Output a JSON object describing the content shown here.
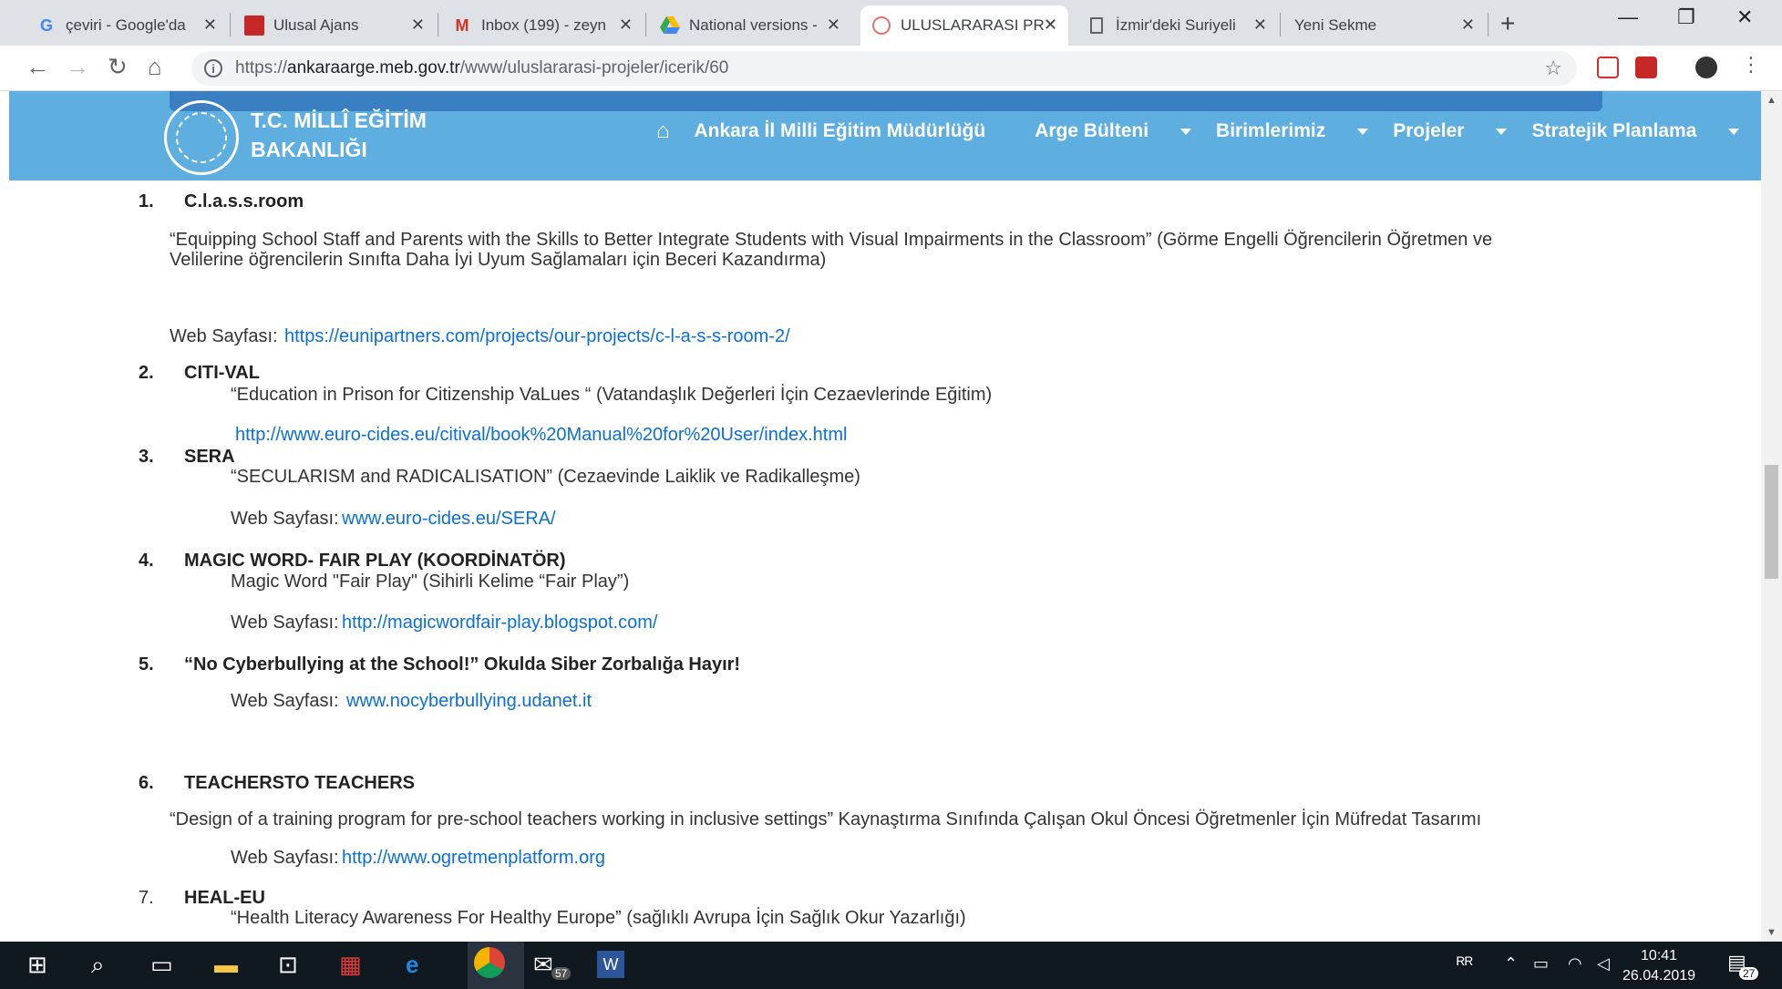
{
  "browser": {
    "tabs": [
      {
        "title": "çeviri - Google'da",
        "icon": "google-g-icon"
      },
      {
        "title": "Ulusal Ajans",
        "icon": "flag-icon"
      },
      {
        "title": "Inbox (199) - zeyn",
        "icon": "gmail-icon"
      },
      {
        "title": "National versions -",
        "icon": "drive-icon"
      },
      {
        "title": "ULUSLARARASI PR",
        "icon": "meb-icon"
      },
      {
        "title": "İzmir'deki Suriyeli",
        "icon": "document-icon"
      },
      {
        "title": "Yeni Sekme",
        "icon": ""
      }
    ],
    "url_prefix": "https://",
    "url_domain": "ankaraarge.meb.gov.tr",
    "url_path": "/www/uluslararasi-projeler/icerik/60"
  },
  "site": {
    "logo_line1": "T.C. MİLLÎ EĞİTİM",
    "logo_line2": "BAKANLIĞI",
    "nav": [
      "Ankara İl Milli Eğitim Müdürlüğü",
      "Arge Bülteni",
      "Birimlerimiz",
      "Projeler",
      "Stratejik Planlama"
    ]
  },
  "projects": {
    "p1": {
      "num": "1.",
      "title": "C.l.a.s.s.room",
      "desc1": "“Equipping School Staff and Parents  with the Skills to Better Integrate Students with Visual Impairments  in the Classroom” (Görme Engelli Öğrencilerin Öğretmen ve",
      "desc2": "Velilerine öğrencilerin Sınıfta Daha İyi Uyum Sağlamaları için Beceri Kazandırma)",
      "web_label": "Web Sayfası:",
      "link": "https://eunipartners.com/projects/our-projects/c-l-a-s-s-room-2/"
    },
    "p2": {
      "num": "2.",
      "title": "CITI-VAL",
      "desc": "“Education in Prison for Citizenship VaLues “ (Vatandaşlık Değerleri İçin Cezaevlerinde Eğitim)",
      "link": "http://www.euro-cides.eu/citival/book%20Manual%20for%20User/index.html"
    },
    "p3": {
      "num": "3.",
      "title": "SERA",
      "desc": "“SECULARISM and RADICALISATION” (Cezaevinde Laiklik ve Radikalleşme)",
      "web_label": "Web Sayfası:",
      "link": "www.euro-cides.eu/SERA/"
    },
    "p4": {
      "num": "4.",
      "title": "MAGIC WORD- FAIR PLAY   (KOORDİNATÖR)",
      "desc": "Magic Word \"Fair Play\"    (Sihirli Kelime “Fair Play”)",
      "web_label": "Web Sayfası:",
      "link": "http://magicwordfair-play.blogspot.com/"
    },
    "p5": {
      "num": "5.",
      "title": "“No Cyberbullying at the School!” Okulda Siber Zorbalığa Hayır!",
      "web_label": "Web Sayfası:",
      "link": "www.nocyberbullying.udanet.it"
    },
    "p6": {
      "num": "6.",
      "title": "TEACHERSTO TEACHERS",
      "desc": "“Design of a training program for pre-school teachers working in inclusive settings” Kaynaştırma Sınıfında Çalışan Okul Öncesi Öğretmenler İçin Müfredat Tasarımı",
      "web_label": "Web Sayfası:",
      "link": "http://www.ogretmenplatform.org"
    },
    "p7": {
      "num": "7.",
      "title": "HEAL-EU",
      "desc": "“Health Literacy Awareness For Healthy Europe”  (sağlıklı Avrupa İçin Sağlık Okur Yazarlığı)"
    }
  },
  "taskbar": {
    "time": "10:41",
    "date": "26.04.2019",
    "mail_badge": "57",
    "notif_badge": "27"
  }
}
